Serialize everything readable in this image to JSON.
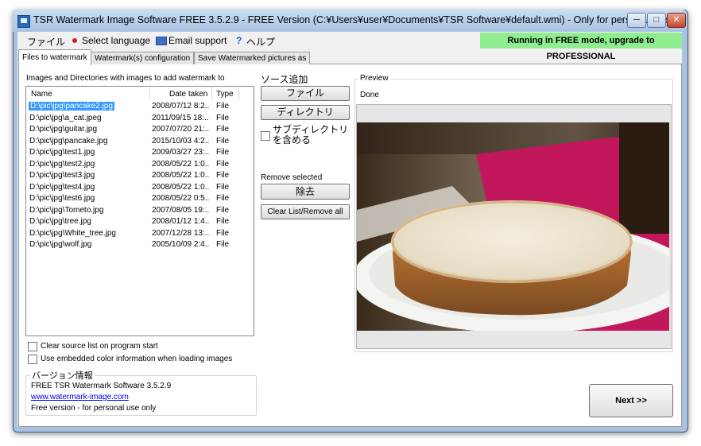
{
  "window": {
    "title": "TSR Watermark Image Software FREE 3.5.2.9 - FREE Version (C:¥Users¥user¥Documents¥TSR Software¥default.wmi) - Only for personal use!",
    "min_label": "─",
    "max_label": "□",
    "close_label": "✕"
  },
  "menu": {
    "file": "ファイル",
    "language": "Select language",
    "email": "Email support",
    "help": "ヘルプ",
    "help_glyph": "?"
  },
  "banner": {
    "text": "Running in FREE mode, upgrade to PROFESSIONAL",
    "color": "#90ee90"
  },
  "tabs": [
    {
      "label": "Files to watermark",
      "active": true
    },
    {
      "label": "Watermark(s) configuration",
      "active": false
    },
    {
      "label": "Save Watermarked pictures as",
      "active": false
    }
  ],
  "file_list": {
    "caption": "Images and Directories with images to add watermark to",
    "columns": {
      "name": "Name",
      "date": "Date taken",
      "type": "Type"
    },
    "rows": [
      {
        "name": "D:\\pic\\jpg\\pancake2.jpg",
        "date": "2008/07/12 8:2...",
        "type": "File",
        "selected": true
      },
      {
        "name": "D:\\pic\\jpg\\a_cat.jpeg",
        "date": "2011/09/15 18:...",
        "type": "File"
      },
      {
        "name": "D:\\pic\\jpg\\guitar.jpg",
        "date": "2007/07/20 21:...",
        "type": "File"
      },
      {
        "name": "D:\\pic\\jpg\\pancake.jpg",
        "date": "2015/10/03 4:2...",
        "type": "File"
      },
      {
        "name": "D:\\pic\\jpg\\test1.jpg",
        "date": "2009/03/27 23:...",
        "type": "File"
      },
      {
        "name": "D:\\pic\\jpg\\test2.jpg",
        "date": "2008/05/22 1:0...",
        "type": "File"
      },
      {
        "name": "D:\\pic\\jpg\\test3.jpg",
        "date": "2008/05/22 1:0...",
        "type": "File"
      },
      {
        "name": "D:\\pic\\jpg\\test4.jpg",
        "date": "2008/05/22 1:0...",
        "type": "File"
      },
      {
        "name": "D:\\pic\\jpg\\test6.jpg",
        "date": "2008/05/22 0:5...",
        "type": "File"
      },
      {
        "name": "D:\\pic\\jpg\\Tometo.jpg",
        "date": "2007/08/05 19:...",
        "type": "File"
      },
      {
        "name": "D:\\pic\\jpg\\tree.jpg",
        "date": "2008/01/12 1:4...",
        "type": "File"
      },
      {
        "name": "D:\\pic\\jpg\\White_tree.jpg",
        "date": "2007/12/28 13:...",
        "type": "File"
      },
      {
        "name": "D:\\pic\\jpg\\wolf.jpg",
        "date": "2005/10/09 2:4...",
        "type": "File"
      }
    ]
  },
  "options": {
    "clear_on_start": "Clear source list on program start",
    "embedded_color": "Use embedded color information when loading images"
  },
  "version": {
    "legend": "バージョン情報",
    "line1": "FREE TSR Watermark Software 3.5.2.9",
    "link": "www.watermark-image.com",
    "line3": "Free version - for personal use only"
  },
  "source": {
    "title": "ソース追加",
    "file_button": "ファイル",
    "dir_button": "ディレクトリ",
    "subdir_label": "サブディレクトリを含める",
    "remove_title": "Remove selected",
    "remove_button": "除去",
    "clear_button": "Clear List/Remove all"
  },
  "preview": {
    "legend": "Preview",
    "status": "Done"
  },
  "next_button": "Next >>"
}
